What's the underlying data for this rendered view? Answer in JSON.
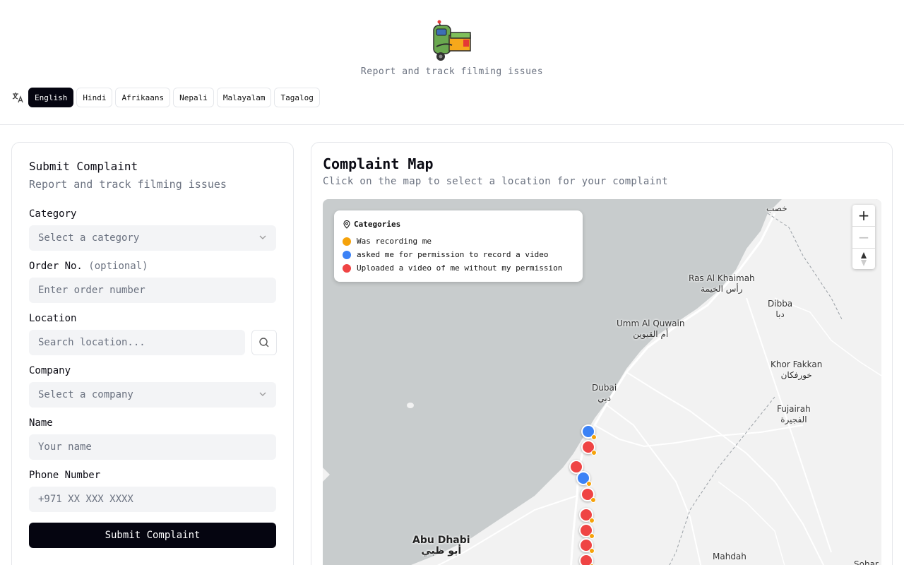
{
  "header": {
    "tagline": "Report and track filming issues",
    "languages": [
      "English",
      "Hindi",
      "Afrikaans",
      "Nepali",
      "Malayalam",
      "Tagalog"
    ],
    "active_language": "English"
  },
  "form": {
    "title": "Submit Complaint",
    "subtitle": "Report and track filming issues",
    "category": {
      "label": "Category",
      "placeholder": "Select a category"
    },
    "order": {
      "label": "Order No.",
      "optional": "(optional)",
      "placeholder": "Enter order number"
    },
    "location": {
      "label": "Location",
      "placeholder": "Search location..."
    },
    "company": {
      "label": "Company",
      "placeholder": "Select a company"
    },
    "name": {
      "label": "Name",
      "placeholder": "Your name"
    },
    "phone": {
      "label": "Phone Number",
      "placeholder": "+971 XX XXX XXXX"
    },
    "submit_label": "Submit Complaint"
  },
  "map": {
    "title": "Complaint Map",
    "subtitle": "Click on the map to select a location for your complaint",
    "legend": {
      "title": "Categories",
      "items": [
        {
          "label": "Was recording me",
          "color": "#f5a20a"
        },
        {
          "label": "asked me for permission to record a video",
          "color": "#3b82f6"
        },
        {
          "label": "Uploaded a video of me without my permission",
          "color": "#ef4444"
        }
      ]
    },
    "zoom_in": "+",
    "zoom_out": "−",
    "places": {
      "khasab": "خصب",
      "ras_al_khaimah": "Ras Al Khaimah",
      "ras_al_khaimah_ar": "رأس الخيمة",
      "dibba": "Dibba",
      "dibba_ar": "دبا",
      "umm_al_quwain": "Umm Al Quwain",
      "umm_al_quwain_ar": "أم القيوين",
      "khor_fakkan": "Khor Fakkan",
      "khor_fakkan_ar": "خورفكان",
      "dubai": "Dubai",
      "dubai_ar": "دبي",
      "fujairah": "Fujairah",
      "fujairah_ar": "الفجيرة",
      "abu_dhabi": "Abu Dhabi",
      "abu_dhabi_ar": "أبو ظبي",
      "mahdah": "Mahdah",
      "sohar": "Sohar"
    },
    "colors": {
      "water": "#c8cccd",
      "land": "#f2f2f2",
      "road": "#ffffff"
    }
  }
}
